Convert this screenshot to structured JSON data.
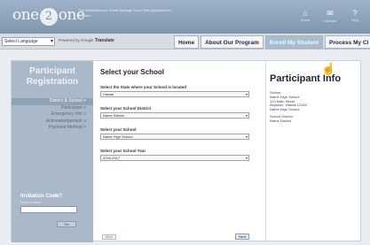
{
  "header": {
    "logo": {
      "pre": "one",
      "mid": "2",
      "post": "one"
    },
    "tagline": "The Destination for Smart Manage Tours Self-Administered Solution",
    "icons": [
      {
        "name": "home-icon",
        "glyph": "⌂",
        "label": "Home"
      },
      {
        "name": "contact-icon",
        "glyph": "✉",
        "label": "Contact"
      },
      {
        "name": "help-icon",
        "glyph": "?",
        "label": "Help"
      }
    ]
  },
  "navbar": {
    "language_select": "Select Language",
    "powered": "Powered by",
    "google": "Google",
    "translate": "Translate",
    "tabs": [
      "Home",
      "About Our Program",
      "Enroll My Student",
      "Process My Cl"
    ],
    "active_tab": 2
  },
  "sidebar": {
    "title_line1": "Participant",
    "title_line2": "Registration",
    "steps": [
      "District & School >",
      "Participant >",
      "Emergency Info >",
      "Acknowledgement >",
      "Payment Method >"
    ],
    "current_step": 0,
    "invite_title": "Invitation Code?",
    "invite_sub": "Enter in here",
    "go_button": "Go"
  },
  "form": {
    "title": "Select your School",
    "fields": [
      {
        "label": "Select the State where your School is located",
        "value": "Hawaii"
      },
      {
        "label": "Select your School District",
        "value": "Name District"
      },
      {
        "label": "Select your School",
        "value": "Name High School"
      },
      {
        "label": "Select your School Year",
        "value": "2016-2017"
      }
    ],
    "back_button": "Back",
    "next_button": "Next"
  },
  "info": {
    "title": "Participant Info",
    "block1": [
      "School:",
      "Name High School",
      "123 Main Street",
      "Anytown, Hawaii 12345",
      "Name High School"
    ],
    "block2": [
      "School District:",
      "Name District"
    ]
  },
  "colors": {
    "accent": "#a8bccf",
    "sidebar": "#a9b9c9",
    "header": "#8fa6bd"
  }
}
